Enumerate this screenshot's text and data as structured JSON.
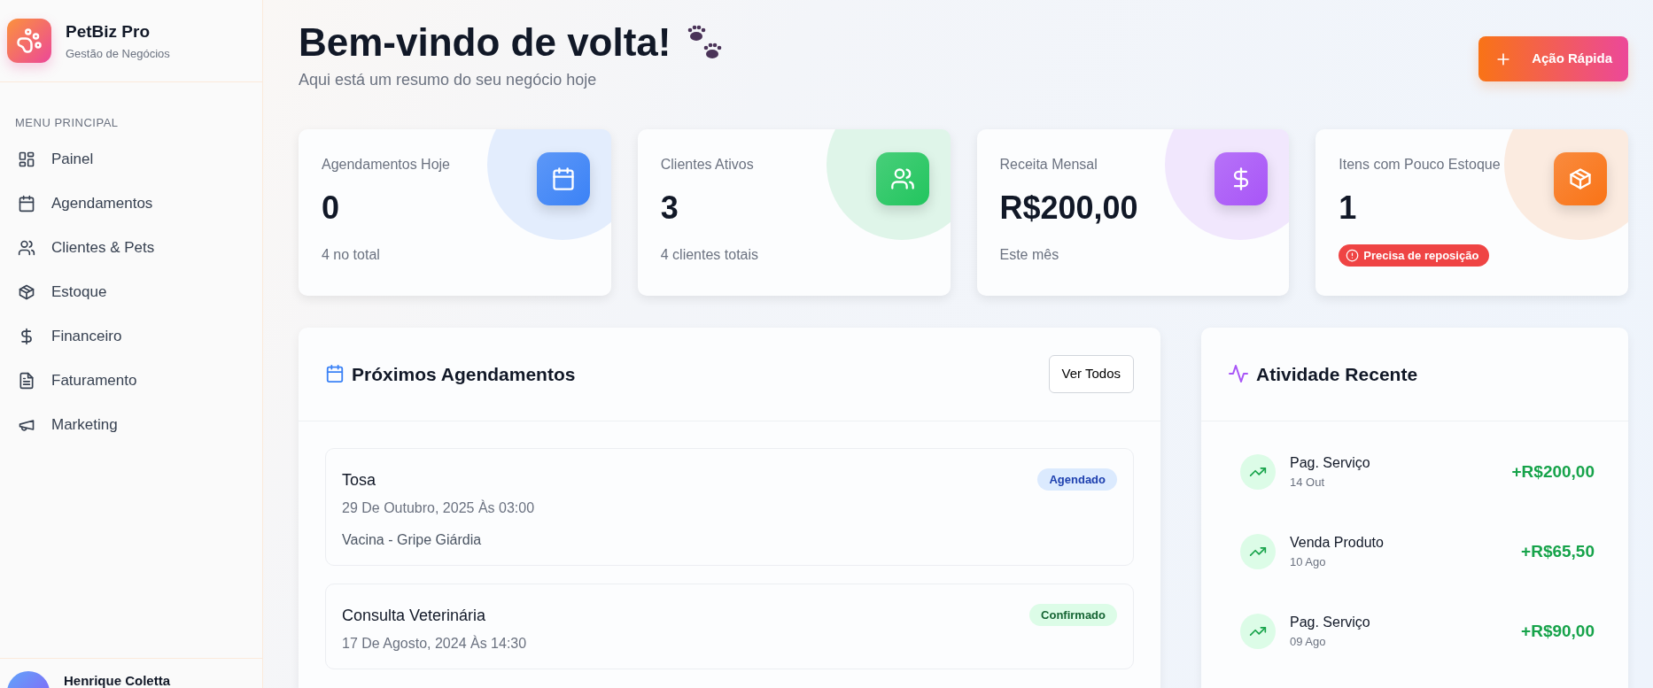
{
  "brand": {
    "name": "PetBiz Pro",
    "tagline": "Gestão de Negócios"
  },
  "sidebar": {
    "section_title": "MENU PRINCIPAL",
    "items": [
      {
        "label": "Painel",
        "kind": "grid",
        "selected": false
      },
      {
        "label": "Agendamentos",
        "kind": "calendar",
        "selected": false
      },
      {
        "label": "Clientes & Pets",
        "kind": "users",
        "selected": false
      },
      {
        "label": "Estoque",
        "kind": "box",
        "selected": false
      },
      {
        "label": "Financeiro",
        "kind": "dollar",
        "selected": false
      },
      {
        "label": "Faturamento",
        "kind": "file",
        "selected": false
      },
      {
        "label": "Marketing",
        "kind": "megaphone",
        "selected": false
      }
    ],
    "user": {
      "name": "Henrique Coletta"
    }
  },
  "header": {
    "title": "Bem-vindo de volta!",
    "subtitle": "Aqui está um resumo do seu negócio hoje",
    "action_button": "Ação Rápida"
  },
  "stats": [
    {
      "label": "Agendamentos Hoje",
      "value": "0",
      "note": "4 no total",
      "color": "#3b82f6",
      "kind": "text"
    },
    {
      "label": "Clientes Ativos",
      "value": "3",
      "note": "4 clientes totais",
      "color": "#22c55e",
      "kind": "text"
    },
    {
      "label": "Receita Mensal",
      "value": "R$200,00",
      "note": "Este mês",
      "color": "#a855f7",
      "kind": "text"
    },
    {
      "label": "Itens com Pouco Estoque",
      "value": "1",
      "note": "Precisa de reposição",
      "color": "#f97316",
      "kind": "alert"
    }
  ],
  "appointments": {
    "title": "Próximos Agendamentos",
    "button": "Ver Todos",
    "items": [
      {
        "service": "Tosa",
        "datetime": "29 De Outubro, 2025 Às 03:00",
        "detail": "Vacina - Gripe Giárdia",
        "status": "Agendado",
        "kind": "scheduled"
      },
      {
        "service": "Consulta Veterinária",
        "datetime": "17 De Agosto, 2024 Às 14:30",
        "status": "Confirmado",
        "kind": "confirmed"
      }
    ]
  },
  "activity": {
    "title": "Atividade Recente",
    "items": [
      {
        "label": "Pag. Serviço",
        "date": "14 Out",
        "amount": "+R$200,00"
      },
      {
        "label": "Venda Produto",
        "date": "10 Ago",
        "amount": "+R$65,50"
      },
      {
        "label": "Pag. Serviço",
        "date": "09 Ago",
        "amount": "+R$90,00"
      }
    ]
  }
}
